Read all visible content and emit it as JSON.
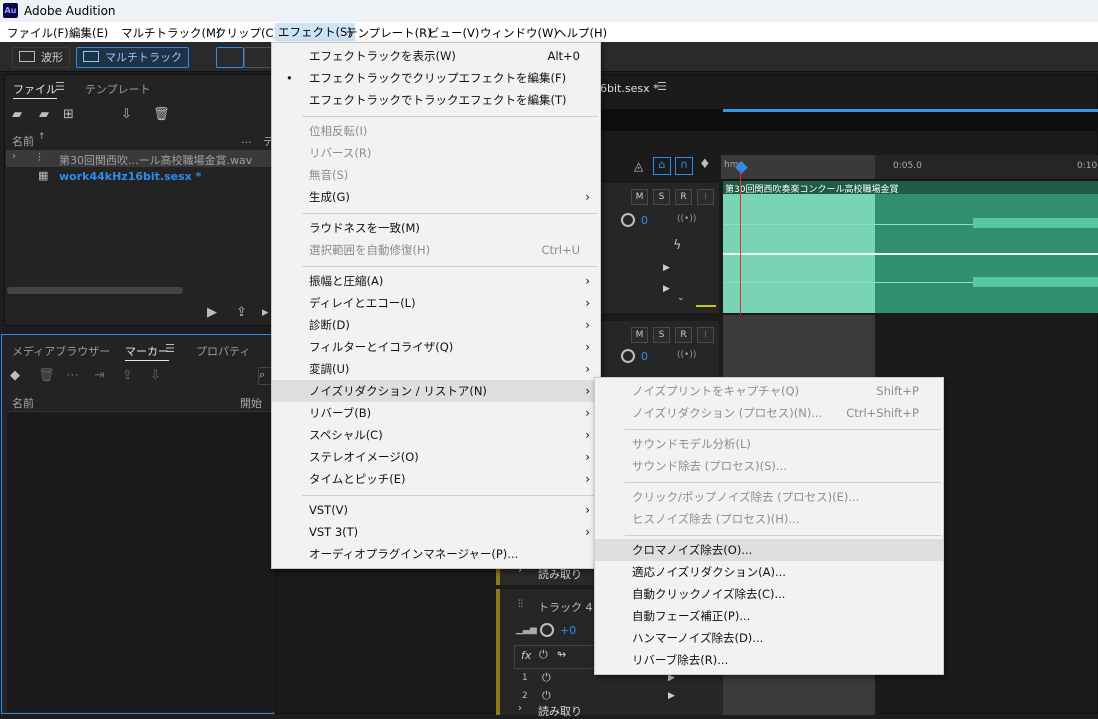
{
  "window": {
    "app_icon": "Au",
    "title": "Adobe Audition"
  },
  "menubar": [
    "ファイル(F)",
    "編集(E)",
    "マルチトラック(M)",
    "クリップ(C)",
    "エフェクト(S)",
    "テンプレート(R)",
    "ビュー(V)",
    "ウィンドウ(W)",
    "ヘルプ(H)"
  ],
  "toolbar": {
    "waveform": "波形",
    "multitrack": "マルチトラック"
  },
  "files_panel": {
    "tab_files": "ファイル",
    "tab_template": "テンプレート",
    "col_name": "名前",
    "col_dots": "...",
    "col_extra": "デ",
    "rows": [
      "第30回関西吹...ール高校職場金賞.wav",
      "work44kHz16bit.sesx *"
    ]
  },
  "media_panel": {
    "tab_media": "メディアブラウザー",
    "tab_marker": "マーカー",
    "tab_props": "プロパティ",
    "col_name": "名前",
    "col_start": "開始"
  },
  "editor": {
    "tab_title": "6bit.sesx *",
    "ruler": {
      "t1": "hms",
      "t2": "0:05.0",
      "t3": "0:10"
    },
    "clip_label": "第30回関西吹奏楽コンクール高校職場金賞",
    "track_btns": [
      "M",
      "S",
      "R",
      "I"
    ],
    "vol_value": "0",
    "read_label": "読み取り",
    "track4": {
      "name": "トラック 4",
      "vol": "+0",
      "fx": "fx",
      "slot1": "1",
      "slot2": "2"
    }
  },
  "effects_menu": {
    "items": [
      {
        "label": "エフェクトラックを表示(W)",
        "shortcut": "Alt+0",
        "disabled": false
      },
      {
        "label": "エフェクトラックでクリップエフェクトを編集(F)",
        "checked": true,
        "disabled": false
      },
      {
        "label": "エフェクトラックでトラックエフェクトを編集(T)",
        "disabled": false
      },
      {
        "label": "位相反転(I)",
        "disabled": true
      },
      {
        "label": "リバース(R)",
        "disabled": true
      },
      {
        "label": "無音(S)",
        "disabled": true
      },
      {
        "label": "生成(G)",
        "submenu": true,
        "disabled": false
      },
      {
        "label": "ラウドネスを一致(M)",
        "disabled": false
      },
      {
        "label": "選択範囲を自動修復(H)",
        "shortcut": "Ctrl+U",
        "disabled": true
      },
      {
        "label": "振幅と圧縮(A)",
        "submenu": true
      },
      {
        "label": "ディレイとエコー(L)",
        "submenu": true
      },
      {
        "label": "診断(D)",
        "submenu": true
      },
      {
        "label": "フィルターとイコライザ(Q)",
        "submenu": true
      },
      {
        "label": "変調(U)",
        "submenu": true
      },
      {
        "label": "ノイズリダクション / リストア(N)",
        "submenu": true,
        "highlighted": true
      },
      {
        "label": "リバーブ(B)",
        "submenu": true
      },
      {
        "label": "スペシャル(C)",
        "submenu": true
      },
      {
        "label": "ステレオイメージ(O)",
        "submenu": true
      },
      {
        "label": "タイムとピッチ(E)",
        "submenu": true
      },
      {
        "label": "VST(V)",
        "submenu": true
      },
      {
        "label": "VST 3(T)",
        "submenu": true
      },
      {
        "label": "オーディオプラグインマネージャー(P)..."
      }
    ],
    "arrow": "›",
    "check": "•"
  },
  "noise_submenu": {
    "items": [
      {
        "label": "ノイズプリントをキャプチャ(Q)",
        "shortcut": "Shift+P",
        "disabled": true
      },
      {
        "label": "ノイズリダクション (プロセス)(N)...",
        "shortcut": "Ctrl+Shift+P",
        "disabled": true
      },
      {
        "label": "サウンドモデル分析(L)",
        "disabled": true
      },
      {
        "label": "サウンド除去 (プロセス)(S)...",
        "disabled": true
      },
      {
        "label": "クリック/ポップノイズ除去 (プロセス)(E)...",
        "disabled": true
      },
      {
        "label": "ヒスノイズ除去 (プロセス)(H)...",
        "disabled": true
      },
      {
        "label": "クロマノイズ除去(O)...",
        "highlighted": true
      },
      {
        "label": "適応ノイズリダクション(A)..."
      },
      {
        "label": "自動クリックノイズ除去(C)..."
      },
      {
        "label": "自動フェーズ補正(P)..."
      },
      {
        "label": "ハンマーノイズ除去(D)..."
      },
      {
        "label": "リバーブ除去(R)..."
      }
    ]
  },
  "colors": {
    "accent": "#2d8ceb",
    "clip": "#2f8f6f",
    "clip_sel": "#79d4b5",
    "playhead": "#e03030"
  }
}
